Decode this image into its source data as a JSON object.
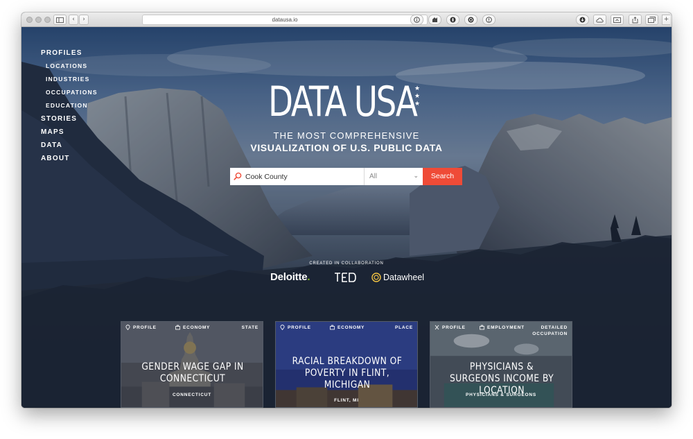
{
  "browser": {
    "url": "datausa.io",
    "reload_glyph": "↻",
    "back_glyph": "‹",
    "forward_glyph": "›",
    "colors": {
      "chrome": "#dcdcdc",
      "url_field": "#ffffff"
    }
  },
  "nav": {
    "profiles": "PROFILES",
    "locations": "LOCATIONS",
    "industries": "INDUSTRIES",
    "occupations": "OCCUPATIONS",
    "education": "EDUCATION",
    "stories": "STORIES",
    "maps": "MAPS",
    "data": "DATA",
    "about": "ABOUT"
  },
  "hero": {
    "logo_text": "DATA USA",
    "star_glyph": "★",
    "tagline_line1": "THE MOST COMPREHENSIVE",
    "tagline_line2": "VISUALIZATION OF U.S. PUBLIC DATA"
  },
  "search": {
    "value": "Cook County",
    "filter_value": "All",
    "chevron": "⌄",
    "button_label": "Search",
    "colors": {
      "button": "#ef4b37"
    }
  },
  "collaboration": {
    "label": "CREATED IN COLLABORATION",
    "deloitte": "Deloitte",
    "deloitte_dot": ".",
    "datawheel": "Datawheel",
    "colors": {
      "deloitte_dot": "#86bc25"
    }
  },
  "cards": [
    {
      "tag_profile": "PROFILE",
      "tag_topic": "ECONOMY",
      "tag_level": "STATE",
      "title": "GENDER WAGE GAP IN CONNECTICUT",
      "subtitle": "CONNECTICUT"
    },
    {
      "tag_profile": "PROFILE",
      "tag_topic": "ECONOMY",
      "tag_level": "PLACE",
      "title": "RACIAL BREAKDOWN OF POVERTY IN FLINT, MICHIGAN",
      "subtitle": "FLINT, MI"
    },
    {
      "tag_profile": "PROFILE",
      "tag_topic": "EMPLOYMENT",
      "tag_level_line1": "DETAILED",
      "tag_level_line2": "OCCUPATION",
      "title": "PHYSICIANS & SURGEONS INCOME BY LOCATION",
      "subtitle": "PHYSICIANS & SURGEONS"
    }
  ]
}
